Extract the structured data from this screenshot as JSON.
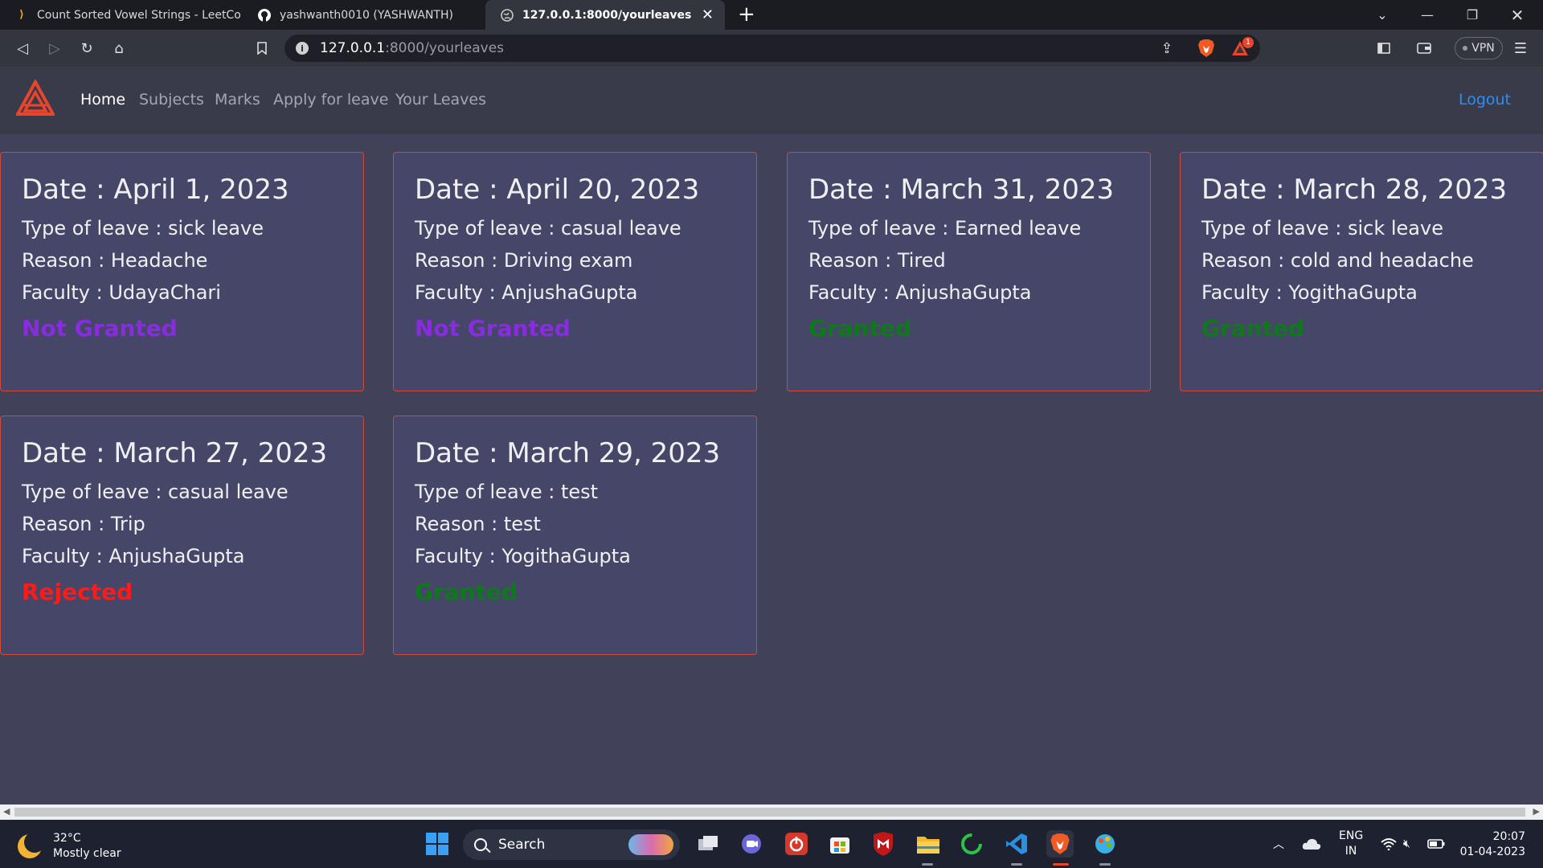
{
  "browser": {
    "tabs": [
      {
        "title": "Count Sorted Vowel Strings - LeetCode"
      },
      {
        "title": "yashwanth0010 (YASHWANTH)"
      },
      {
        "title": "127.0.0.1:8000/yourleaves"
      }
    ],
    "url_host": "127.0.0.1",
    "url_path": ":8000/yourleaves",
    "notification_count": "1",
    "vpn_label": "VPN"
  },
  "app": {
    "nav": {
      "home": "Home",
      "subjects": "Subjects",
      "marks": "Marks",
      "apply": "Apply for leave",
      "your_leaves": "Your Leaves",
      "logout": "Logout"
    },
    "leaves": [
      {
        "date": "Date : April 1, 2023",
        "type": "Type of leave : sick leave",
        "reason": "Reason : Headache",
        "faculty": "Faculty : UdayaChari",
        "status": "Not Granted",
        "status_color": "#8a2be2"
      },
      {
        "date": "Date : April 20, 2023",
        "type": "Type of leave : casual leave",
        "reason": "Reason : Driving exam",
        "faculty": "Faculty : AnjushaGupta",
        "status": "Not Granted",
        "status_color": "#8a2be2"
      },
      {
        "date": "Date : March 31, 2023",
        "type": "Type of leave : Earned leave",
        "reason": "Reason : Tired",
        "faculty": "Faculty : AnjushaGupta",
        "status": "Granted",
        "status_color": "#0d7a1a"
      },
      {
        "date": "Date : March 28, 2023",
        "type": "Type of leave : sick leave",
        "reason": "Reason : cold and headache",
        "faculty": "Faculty : YogithaGupta",
        "status": "Granted",
        "status_color": "#0d7a1a"
      },
      {
        "date": "Date : March 27, 2023",
        "type": "Type of leave : casual leave",
        "reason": "Reason : Trip",
        "faculty": "Faculty : AnjushaGupta",
        "status": "Rejected",
        "status_color": "#ff1a1a"
      },
      {
        "date": "Date : March 29, 2023",
        "type": "Type of leave : test",
        "reason": "Reason : test",
        "faculty": "Faculty : YogithaGupta",
        "status": "Granted",
        "status_color": "#0d7a1a"
      }
    ]
  },
  "taskbar": {
    "weather_temp": "32°C",
    "weather_desc": "Mostly clear",
    "search_label": "Search",
    "lang_top": "ENG",
    "lang_bottom": "IN",
    "time": "20:07",
    "date": "01-04-2023"
  },
  "colors": {
    "page_bg": "#41425a",
    "card_bg": "#464668",
    "card_border": "#d04a3a",
    "logout": "#2c8ef5"
  }
}
